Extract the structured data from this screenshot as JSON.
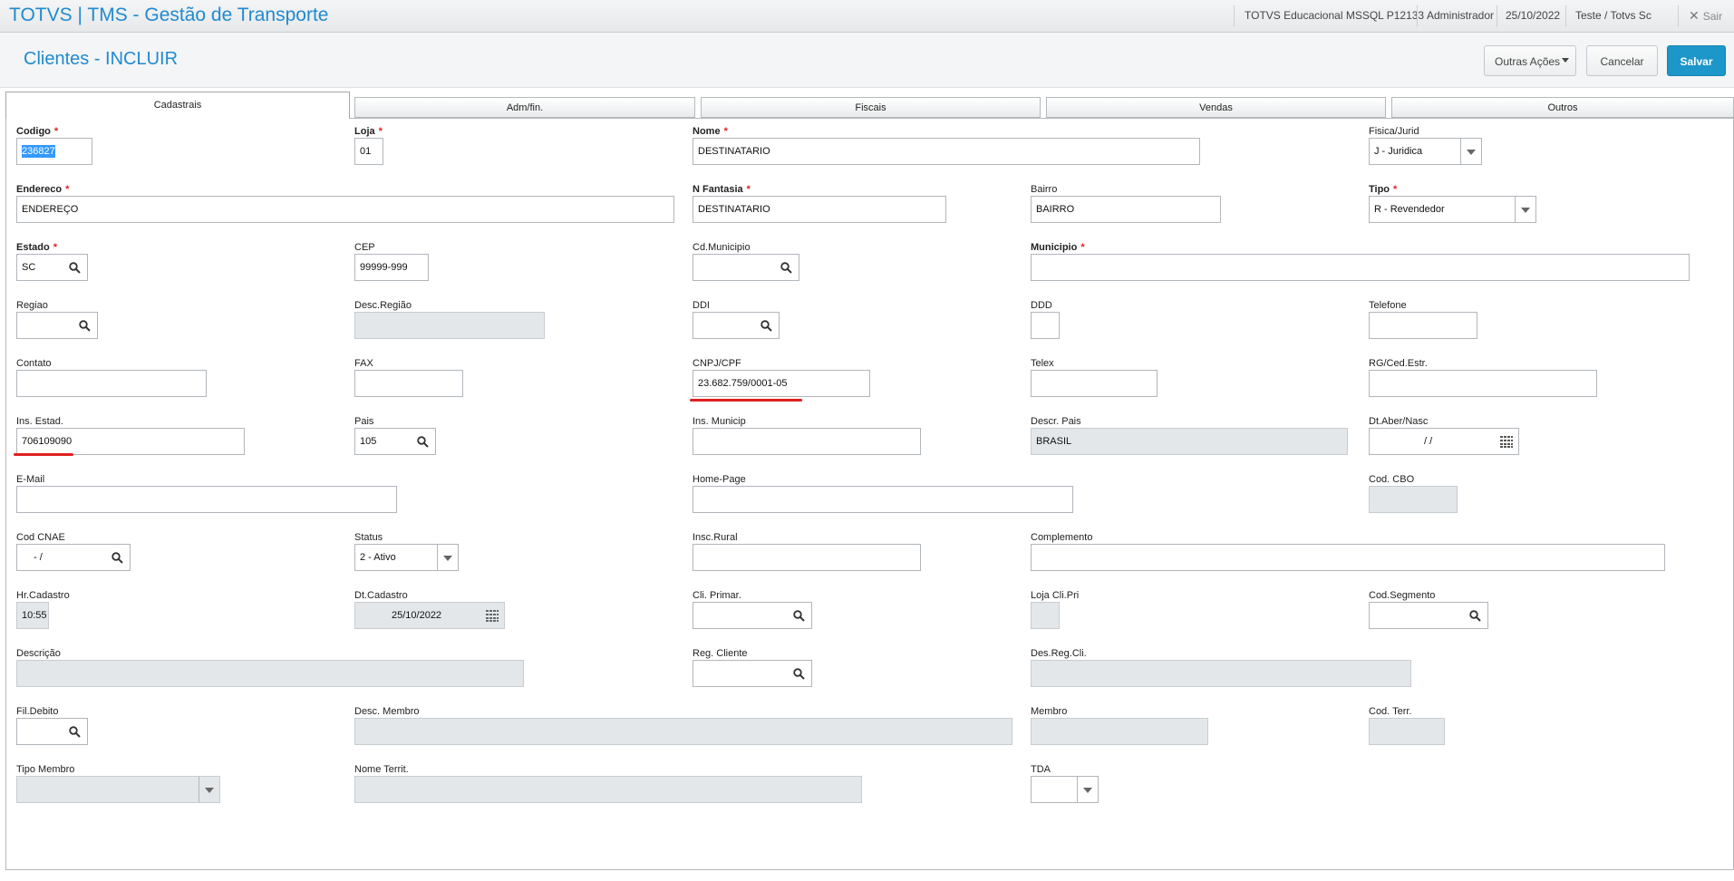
{
  "topbar": {
    "title": "TOTVS | TMS - Gestão de Transporte",
    "environment": "TOTVS Educacional MSSQL P12133",
    "user": "Administrador",
    "date": "25/10/2022",
    "company": "Teste / Totvs Sc",
    "exit_label": "Sair"
  },
  "header": {
    "page_title": "Clientes - INCLUIR",
    "more_actions_label": "Outras Ações",
    "cancel_label": "Cancelar",
    "save_label": "Salvar"
  },
  "tabs": [
    {
      "label": "Cadastrais",
      "active": true
    },
    {
      "label": "Adm/fin.",
      "active": false
    },
    {
      "label": "Fiscais",
      "active": false
    },
    {
      "label": "Vendas",
      "active": false
    },
    {
      "label": "Outros",
      "active": false
    }
  ],
  "fields": {
    "codigo": {
      "label": "Codigo",
      "value": "236827"
    },
    "loja": {
      "label": "Loja",
      "value": "01"
    },
    "nome": {
      "label": "Nome",
      "value": "DESTINATARIO"
    },
    "fisica_jurid": {
      "label": "Fisica/Jurid",
      "value": "J - Juridica"
    },
    "endereco": {
      "label": "Endereco",
      "value": "ENDEREÇO"
    },
    "n_fantasia": {
      "label": "N Fantasia",
      "value": "DESTINATARIO"
    },
    "bairro": {
      "label": "Bairro",
      "value": "BAIRRO"
    },
    "tipo": {
      "label": "Tipo",
      "value": "R - Revendedor"
    },
    "estado": {
      "label": "Estado",
      "value": "SC"
    },
    "cep": {
      "label": "CEP",
      "value": "99999-999"
    },
    "cd_municipio": {
      "label": "Cd.Municipio",
      "value": ""
    },
    "municipio": {
      "label": "Municipio",
      "value": ""
    },
    "regiao": {
      "label": "Regiao",
      "value": ""
    },
    "desc_regiao": {
      "label": "Desc.Região",
      "value": ""
    },
    "ddi": {
      "label": "DDI",
      "value": ""
    },
    "ddd": {
      "label": "DDD",
      "value": ""
    },
    "telefone": {
      "label": "Telefone",
      "value": ""
    },
    "contato": {
      "label": "Contato",
      "value": ""
    },
    "fax": {
      "label": "FAX",
      "value": ""
    },
    "cnpj_cpf": {
      "label": "CNPJ/CPF",
      "value": "23.682.759/0001-05"
    },
    "telex": {
      "label": "Telex",
      "value": ""
    },
    "rg_ced_estr": {
      "label": "RG/Ced.Estr.",
      "value": ""
    },
    "ins_estad": {
      "label": "Ins. Estad.",
      "value": "706109090"
    },
    "pais": {
      "label": "Pais",
      "value": "105"
    },
    "ins_municip": {
      "label": "Ins. Municip",
      "value": ""
    },
    "descr_pais": {
      "label": "Descr. Pais",
      "value": "BRASIL"
    },
    "dt_aber_nasc": {
      "label": "Dt.Aber/Nasc",
      "value": "/ /"
    },
    "email": {
      "label": "E-Mail",
      "value": ""
    },
    "home_page": {
      "label": "Home-Page",
      "value": ""
    },
    "cod_cbo": {
      "label": "Cod. CBO",
      "value": ""
    },
    "cod_cnae": {
      "label": "Cod CNAE",
      "value": "- /"
    },
    "status": {
      "label": "Status",
      "value": "2 - Ativo"
    },
    "insc_rural": {
      "label": "Insc.Rural",
      "value": ""
    },
    "complemento": {
      "label": "Complemento",
      "value": ""
    },
    "hr_cadastro": {
      "label": "Hr.Cadastro",
      "value": "10:55"
    },
    "dt_cadastro": {
      "label": "Dt.Cadastro",
      "value": "25/10/2022"
    },
    "cli_primar": {
      "label": "Cli. Primar.",
      "value": ""
    },
    "loja_cli_pri": {
      "label": "Loja Cli.Pri",
      "value": ""
    },
    "cod_segmento": {
      "label": "Cod.Segmento",
      "value": ""
    },
    "descricao": {
      "label": "Descrição",
      "value": ""
    },
    "reg_cliente": {
      "label": "Reg. Cliente",
      "value": ""
    },
    "des_reg_cli": {
      "label": "Des.Reg.Cli.",
      "value": ""
    },
    "fil_debito": {
      "label": "Fil.Debito",
      "value": ""
    },
    "desc_membro": {
      "label": "Desc. Membro",
      "value": ""
    },
    "membro": {
      "label": "Membro",
      "value": ""
    },
    "cod_terr": {
      "label": "Cod. Terr.",
      "value": ""
    },
    "tipo_membro": {
      "label": "Tipo Membro",
      "value": ""
    },
    "nome_territ": {
      "label": "Nome Territ.",
      "value": ""
    },
    "tda": {
      "label": "TDA",
      "value": ""
    }
  },
  "colors": {
    "accent": "#1f8ad1",
    "save_button": "#1d96c9",
    "required_marker": "#e02020",
    "readonly_field": "#e4e7ea"
  },
  "icons": {
    "lookup": "search-icon",
    "dropdown": "chevron-down-icon",
    "calendar": "calendar-icon",
    "close": "close-icon"
  }
}
